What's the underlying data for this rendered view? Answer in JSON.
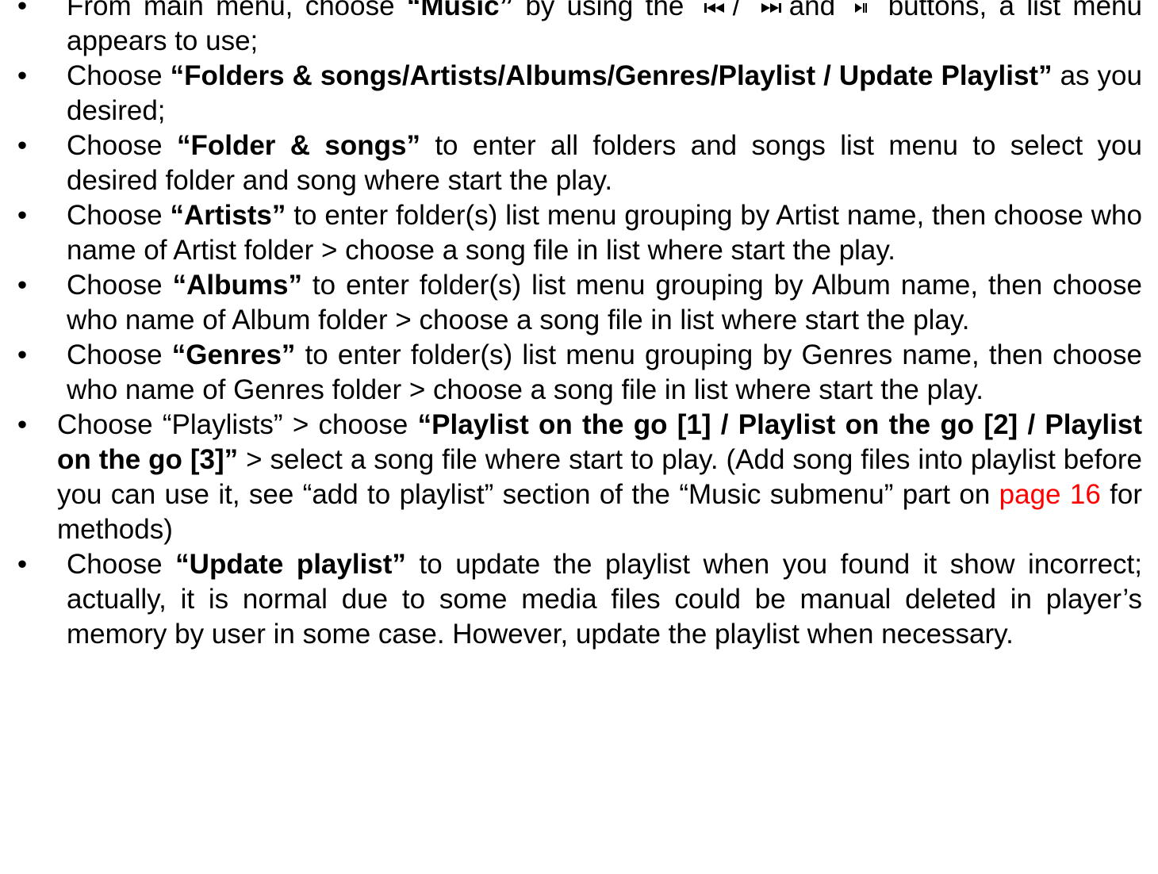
{
  "bullets": {
    "symbol": "•",
    "items": [
      {
        "p1": "From main menu, choose ",
        "b1": "“Music”",
        "p2": " by using the",
        "sep1": "/",
        "and": "and",
        "p3": "buttons, a list menu appears to use;"
      },
      {
        "p1": "Choose ",
        "b1": "“Folders & songs/Artists/Albums/Genres/Playlist / Update Playlist”",
        "p2": " as you desired;"
      },
      {
        "p1": "Choose ",
        "b1": "“Folder & songs”",
        "p2": " to enter all folders and songs list menu to select you desired folder and song where start the play."
      },
      {
        "p1": "Choose ",
        "b1": "“Artists”",
        "p2": " to enter folder(s) list menu grouping by Artist name, then choose who name of Artist folder > choose a song file in list where start the play."
      },
      {
        "p1": "Choose ",
        "b1": "“Albums”",
        "p2": " to enter folder(s) list menu grouping by Album name, then choose who name of Album folder > choose a song file in list where start the play."
      },
      {
        "p1": "Choose ",
        "b1": "“Genres”",
        "p2": " to enter folder(s) list menu grouping by Genres name, then choose who name of Genres folder > choose a song file in list where start the play."
      },
      {
        "p1": "Choose “Playlists” > choose ",
        "b1": "“Playlist on the go [1] / Playlist on the go [2] / Playlist on the go [3]”",
        "p2": " > select a song file where start to play. (Add song files into playlist before you can use it, see “add to playlist” section of the “Music submenu” part on ",
        "link": "page 16",
        "p3": " for methods)"
      },
      {
        "p1": "Choose ",
        "b1": "“Update playlist”",
        "p2": " to update the playlist when you found it show incorrect; actually, it is normal due to some media files could be manual deleted in player’s memory by user in some case. However, update the playlist when necessary."
      }
    ]
  },
  "icons": {
    "prev": "skip-previous-icon",
    "next": "skip-next-icon",
    "play_pause": "play-pause-icon"
  },
  "colors": {
    "text": "#000000",
    "link": "#ff0000"
  }
}
